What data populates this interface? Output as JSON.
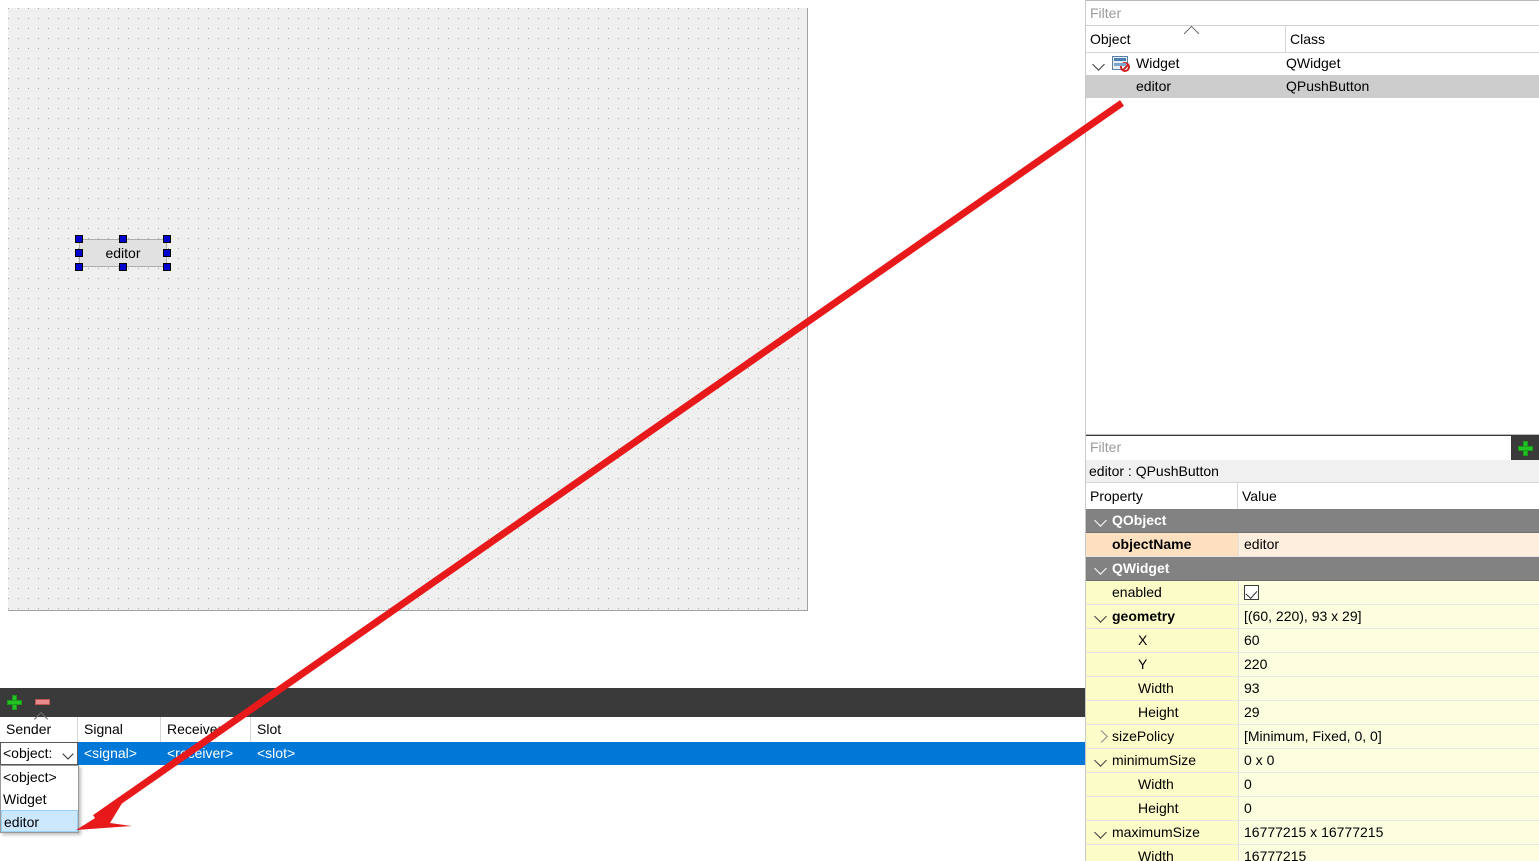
{
  "canvas": {
    "widget": {
      "label": "editor"
    }
  },
  "object_inspector": {
    "filter_placeholder": "Filter",
    "columns": [
      "Object",
      "Class"
    ],
    "rows": [
      {
        "name": "Widget",
        "class": "QWidget",
        "depth": 0,
        "expanded": true,
        "selected": false
      },
      {
        "name": "editor",
        "class": "QPushButton",
        "depth": 1,
        "expanded": false,
        "selected": true
      }
    ]
  },
  "property_editor": {
    "filter_placeholder": "Filter",
    "add_button_label": "+",
    "title": "editor : QPushButton",
    "columns": [
      "Property",
      "Value"
    ],
    "rows": [
      {
        "label": "QObject",
        "value": "",
        "kind": "group",
        "indent": 26,
        "chevron": "expanded"
      },
      {
        "label": "objectName",
        "value": "editor",
        "kind": "peach",
        "indent": 26,
        "chevron": "none",
        "bold": true
      },
      {
        "label": "QWidget",
        "value": "",
        "kind": "group",
        "indent": 26,
        "chevron": "expanded"
      },
      {
        "label": "enabled",
        "value": "",
        "kind": "yellow",
        "indent": 26,
        "chevron": "none",
        "checkbox": true
      },
      {
        "label": "geometry",
        "value": "[(60, 220), 93 x 29]",
        "kind": "yellow",
        "indent": 26,
        "chevron": "expanded",
        "bold": true
      },
      {
        "label": "X",
        "value": "60",
        "kind": "yellow",
        "indent": 52,
        "chevron": "none"
      },
      {
        "label": "Y",
        "value": "220",
        "kind": "yellow",
        "indent": 52,
        "chevron": "none"
      },
      {
        "label": "Width",
        "value": "93",
        "kind": "yellow",
        "indent": 52,
        "chevron": "none"
      },
      {
        "label": "Height",
        "value": "29",
        "kind": "yellow",
        "indent": 52,
        "chevron": "none"
      },
      {
        "label": "sizePolicy",
        "value": "[Minimum, Fixed, 0, 0]",
        "kind": "yellow",
        "indent": 26,
        "chevron": "collapsed"
      },
      {
        "label": "minimumSize",
        "value": "0 x 0",
        "kind": "yellow",
        "indent": 26,
        "chevron": "expanded"
      },
      {
        "label": "Width",
        "value": "0",
        "kind": "yellow",
        "indent": 52,
        "chevron": "none"
      },
      {
        "label": "Height",
        "value": "0",
        "kind": "yellow",
        "indent": 52,
        "chevron": "none"
      },
      {
        "label": "maximumSize",
        "value": "16777215 x 16777215",
        "kind": "yellow",
        "indent": 26,
        "chevron": "expanded"
      },
      {
        "label": "Width",
        "value": "16777215",
        "kind": "yellow",
        "indent": 52,
        "chevron": "none"
      }
    ]
  },
  "signal_slot_editor": {
    "toolbar": {
      "add_label": "+",
      "remove_label": "-"
    },
    "columns": [
      "Sender",
      "Signal",
      "Receiver",
      "Slot"
    ],
    "row": {
      "sender": "<object:",
      "signal": "<signal>",
      "receiver": "<receiver>",
      "slot": "<slot>"
    },
    "sender_dropdown": {
      "options": [
        "<object>",
        "Widget",
        "editor"
      ],
      "selected": "editor"
    }
  },
  "colors": {
    "selection_blue": "#0078d7",
    "annotation_red": "#e8191b",
    "handle_blue": "#0000cc",
    "group_gray": "#828282",
    "yellow_row": "#fcfcc8",
    "peach_row": "#fde0c0",
    "canvas_bg": "#efefef",
    "toolbar_dark": "#3a3a3a"
  }
}
